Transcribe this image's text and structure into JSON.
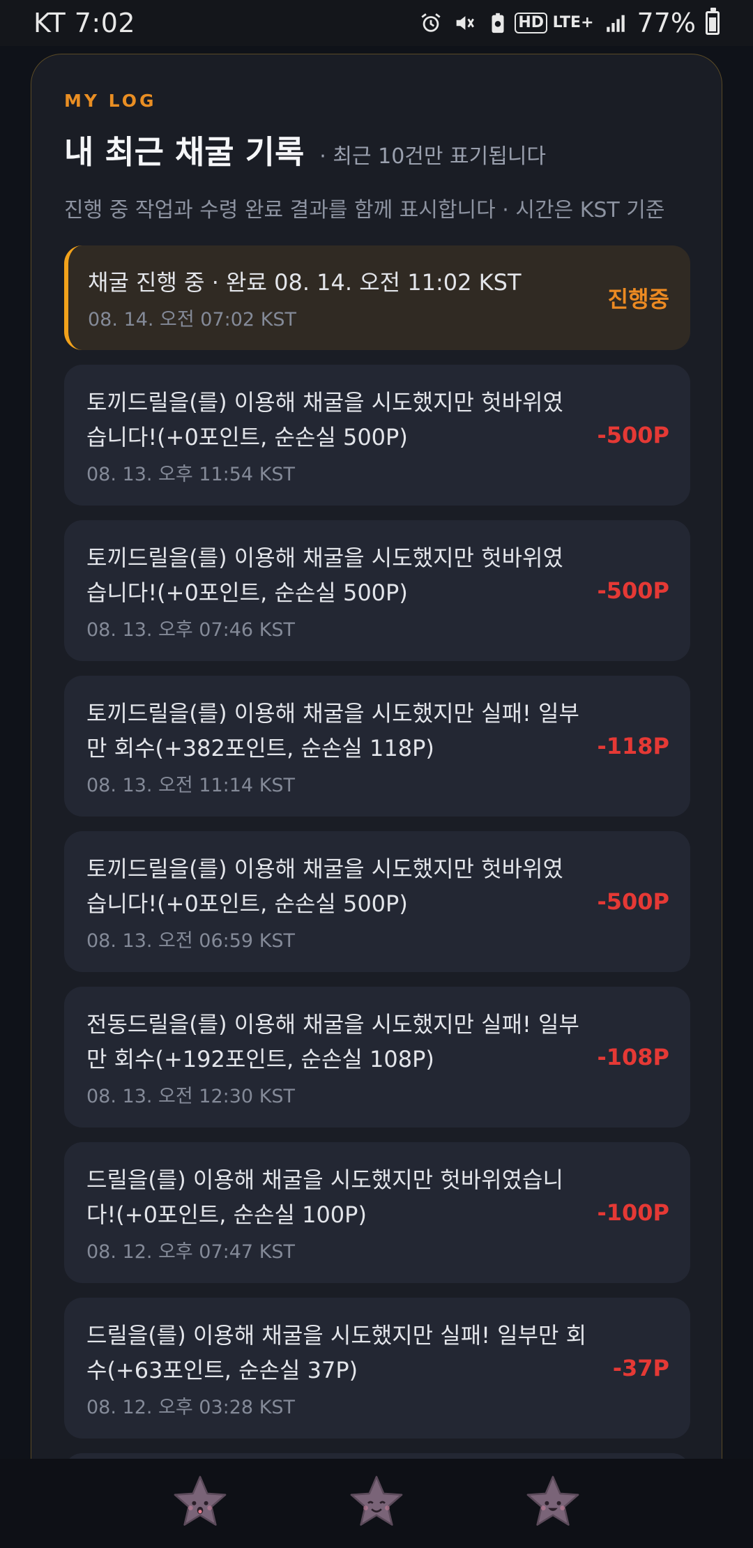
{
  "status_bar": {
    "carrier_time": "KT 7:02",
    "hd_label": "HD",
    "network_label": "LTE+",
    "battery_percent": "77%",
    "icons": [
      "alarm-icon",
      "mute-icon",
      "battery-saver-icon",
      "hd-voice-icon",
      "lte-icon",
      "signal-icon",
      "battery-icon"
    ]
  },
  "panel": {
    "eyebrow": "MY LOG",
    "title": "내 최근 채굴 기록",
    "subtitle": "· 최근 10건만 표기됩니다",
    "description": "진행 중 작업과 수령 완료 결과를 함께 표시합니다 · 시간은 KST 기준",
    "accent_color": "#e98e23",
    "loss_color": "#e53935"
  },
  "records": [
    {
      "message": "채굴 진행 중 · 완료 08. 14. 오전 11:02 KST",
      "time": "08. 14. 오전 07:02 KST",
      "amount": "진행중",
      "active": true
    },
    {
      "message": "토끼드릴을(를) 이용해 채굴을 시도했지만 헛바위였습니다!(+0포인트, 순손실 500P)",
      "time": "08. 13. 오후 11:54 KST",
      "amount": "-500P"
    },
    {
      "message": "토끼드릴을(를) 이용해 채굴을 시도했지만 헛바위였습니다!(+0포인트, 순손실 500P)",
      "time": "08. 13. 오후 07:46 KST",
      "amount": "-500P"
    },
    {
      "message": "토끼드릴을(를) 이용해 채굴을 시도했지만 실패! 일부만 회수(+382포인트, 순손실 118P)",
      "time": "08. 13. 오전 11:14 KST",
      "amount": "-118P"
    },
    {
      "message": "토끼드릴을(를) 이용해 채굴을 시도했지만 헛바위였습니다!(+0포인트, 순손실 500P)",
      "time": "08. 13. 오전 06:59 KST",
      "amount": "-500P"
    },
    {
      "message": "전동드릴을(를) 이용해 채굴을 시도했지만 실패! 일부만 회수(+192포인트, 순손실 108P)",
      "time": "08. 13. 오전 12:30 KST",
      "amount": "-108P"
    },
    {
      "message": "드릴을(를) 이용해 채굴을 시도했지만 헛바위였습니다!(+0포인트, 순손실 100P)",
      "time": "08. 12. 오후 07:47 KST",
      "amount": "-100P"
    },
    {
      "message": "드릴을(를) 이용해 채굴을 시도했지만 실패! 일부만 회수(+63포인트, 순손실 37P)",
      "time": "08. 12. 오후 03:28 KST",
      "amount": "-37P"
    }
  ],
  "bottom_nav": {
    "items": [
      {
        "icon": "star-surprised-icon"
      },
      {
        "icon": "star-smile-icon"
      },
      {
        "icon": "star-happy-icon"
      }
    ]
  }
}
